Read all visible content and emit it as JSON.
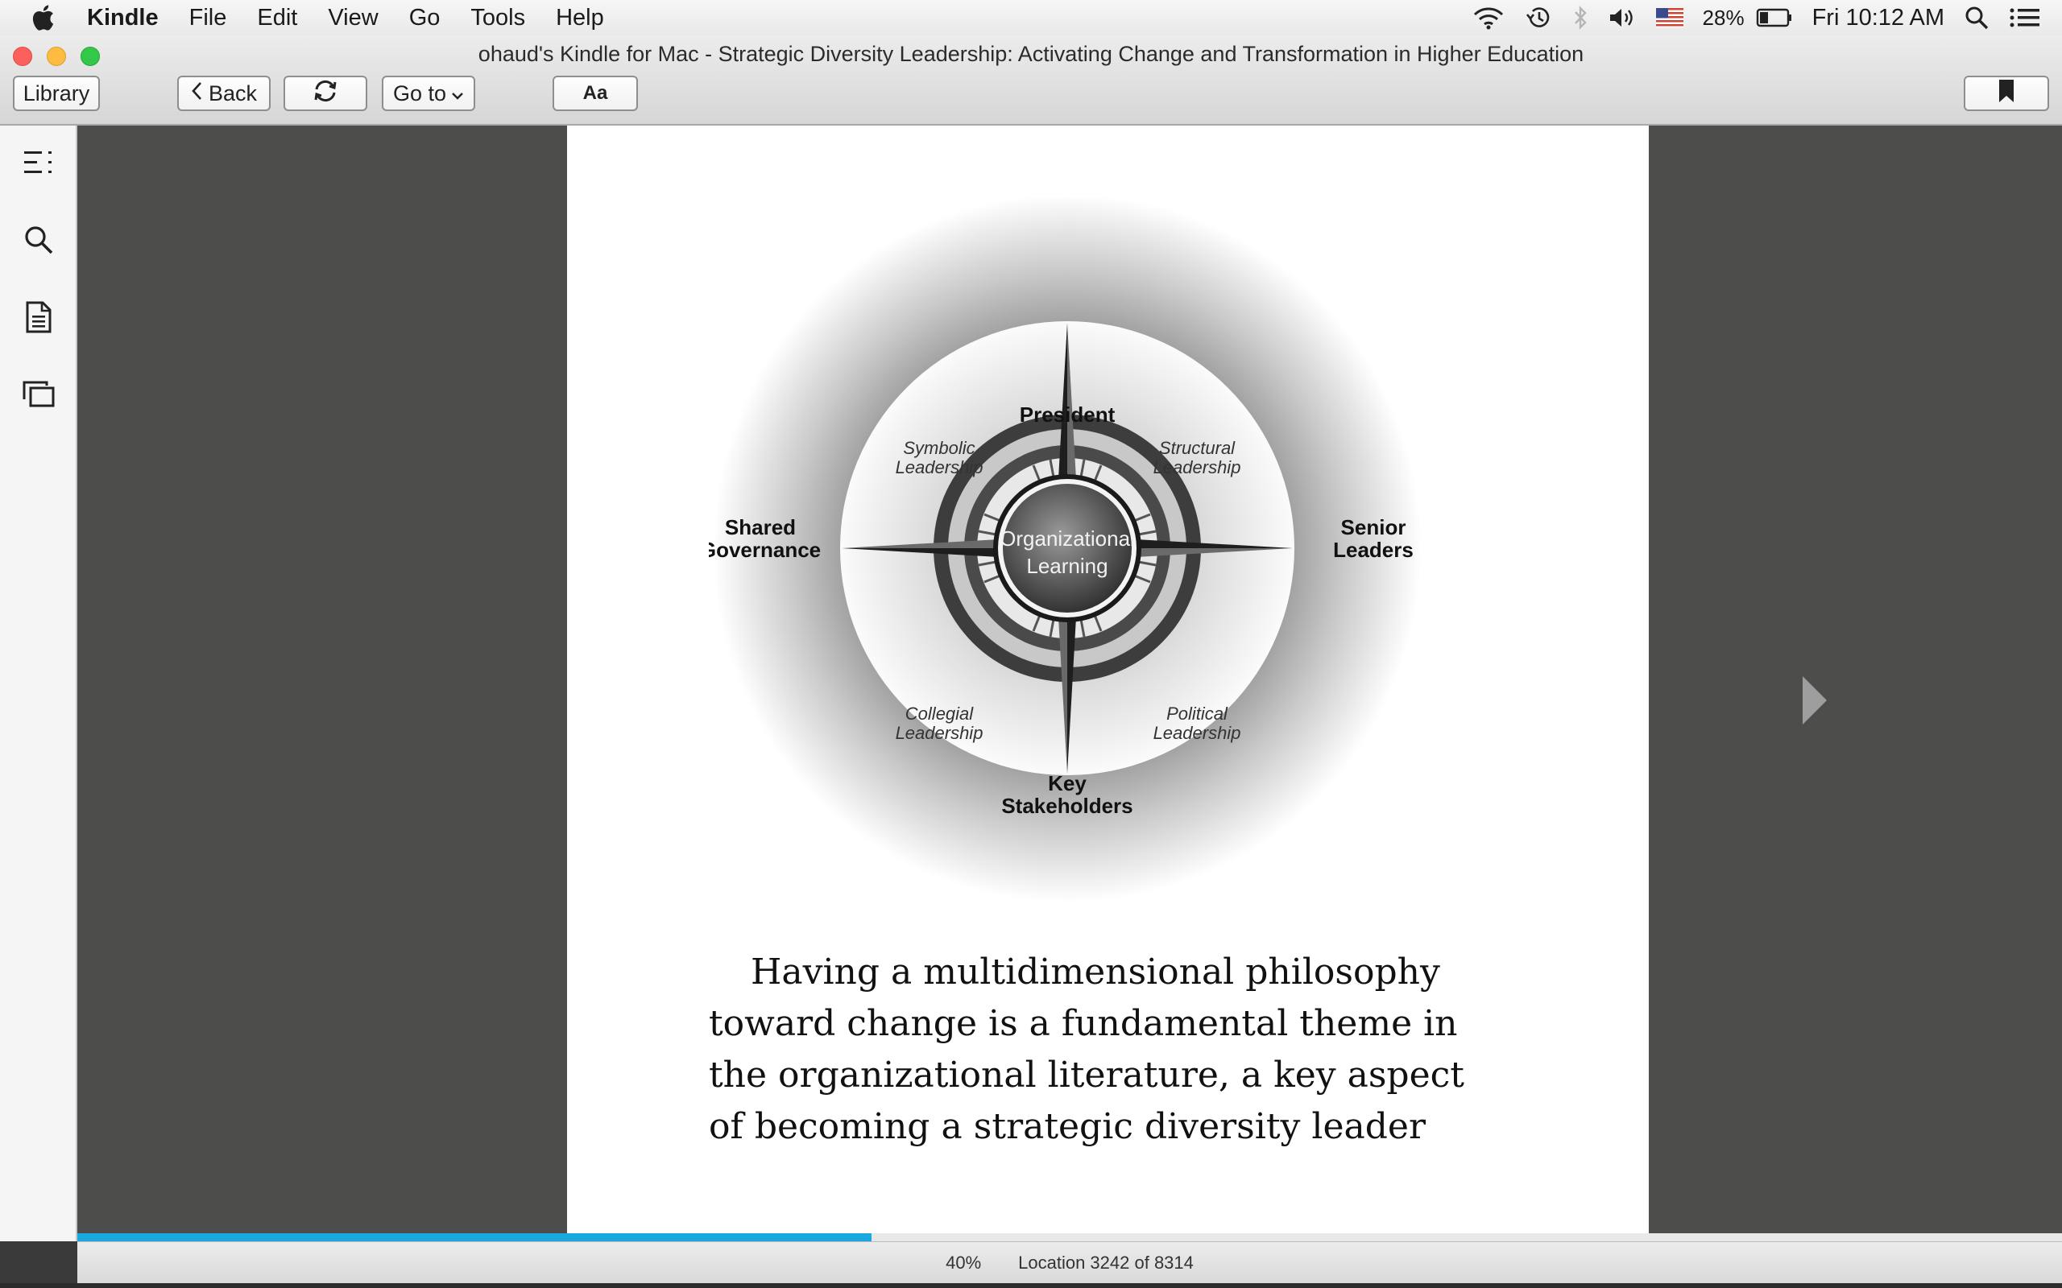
{
  "menubar": {
    "app_name": "Kindle",
    "menus": [
      "File",
      "Edit",
      "View",
      "Go",
      "Tools",
      "Help"
    ],
    "battery_percent": "28%",
    "clock": "Fri 10:12 AM",
    "status_icons": [
      "wifi-icon",
      "time-machine-icon",
      "bluetooth-icon",
      "volume-icon",
      "us-flag-input-icon",
      "battery-icon",
      "spotlight-icon",
      "notification-center-icon"
    ]
  },
  "window": {
    "title": "ohaud's Kindle for Mac - Strategic Diversity Leadership: Activating Change and Transformation in Higher Education"
  },
  "toolbar": {
    "library_label": "Library",
    "back_label": "Back",
    "goto_label": "Go to",
    "font_label": "Aa"
  },
  "sidebar": {
    "items": [
      "table-of-contents-icon",
      "search-icon",
      "notes-icon",
      "flashcards-icon"
    ]
  },
  "figure": {
    "top_label": "President",
    "left_label_1": "Shared",
    "left_label_2": "Governance",
    "right_label_1": "Senior",
    "right_label_2": "Leaders",
    "bottom_label_1": "Key",
    "bottom_label_2": "Stakeholders",
    "center_label_1": "Organizational",
    "center_label_2": "Learning",
    "q_symbolic_1": "Symbolic",
    "q_symbolic_2": "Leadership",
    "q_structural_1": "Structural",
    "q_structural_2": "Leadership",
    "q_collegial_1": "Collegial",
    "q_collegial_2": "Leadership",
    "q_political_1": "Political",
    "q_political_2": "Leadership"
  },
  "body": {
    "lines": [
      "Having a multidimensional philosophy",
      "toward change is a fundamental theme in",
      "the organizational literature, a key aspect",
      "of becoming a strategic diversity leader"
    ]
  },
  "status": {
    "percent": "40%",
    "location": "Location 3242 of 8314",
    "progress_fraction": 0.4,
    "progress_color": "#1aa8de"
  }
}
